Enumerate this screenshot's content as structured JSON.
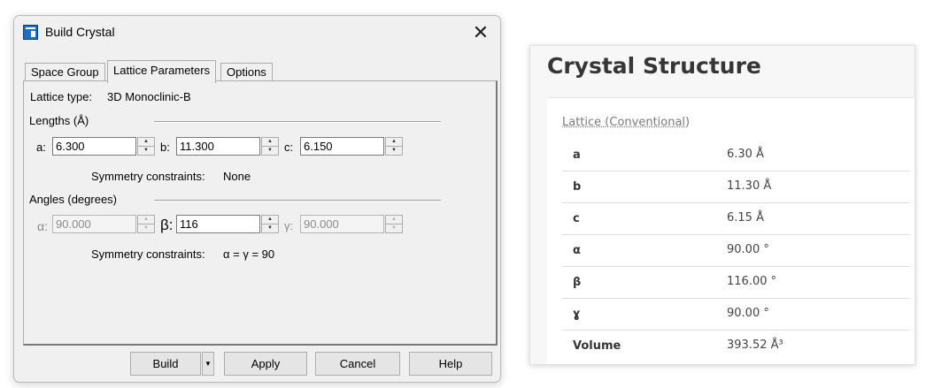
{
  "dialog": {
    "title": "Build Crystal",
    "close_glyph": "✕",
    "tabs": [
      "Space Group",
      "Lattice Parameters",
      "Options"
    ],
    "lattice_type_label": "Lattice type:",
    "lattice_type_value": "3D Monoclinic-B",
    "lengths_label": "Lengths (Å)",
    "a_label": "a:",
    "a_value": "6.300",
    "b_label": "b:",
    "b_value": "11.300",
    "c_label": "c:",
    "c_value": "6.150",
    "sym_label": "Symmetry constraints:",
    "sym_lengths_value": "None",
    "angles_label": "Angles (degrees)",
    "alpha_label": "α:",
    "alpha_value": "90.000",
    "beta_label": "β:",
    "beta_value": "116",
    "gamma_label": "γ:",
    "gamma_value": "90.000",
    "sym_angles_value": "α = γ = 90",
    "buttons": {
      "build": "Build",
      "apply": "Apply",
      "cancel": "Cancel",
      "help": "Help"
    }
  },
  "card": {
    "title": "Crystal Structure",
    "section": "Lattice (Conventional)",
    "rows": [
      {
        "key": "a",
        "value": "6.30 Å"
      },
      {
        "key": "b",
        "value": "11.30 Å"
      },
      {
        "key": "c",
        "value": "6.15 Å"
      },
      {
        "key": "α",
        "value": "90.00 °"
      },
      {
        "key": "β",
        "value": "116.00 °"
      },
      {
        "key": "ɣ",
        "value": "90.00 °"
      },
      {
        "key": "Volume",
        "value": "393.52 Å³"
      }
    ]
  }
}
